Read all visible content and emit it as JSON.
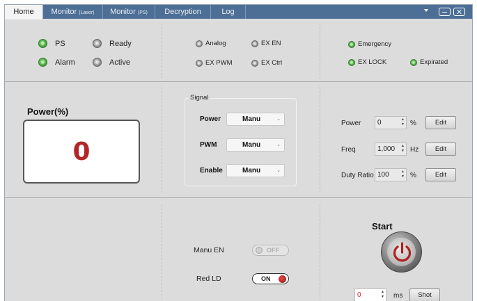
{
  "tabs": [
    {
      "label": "Home",
      "sub": ""
    },
    {
      "label": "Monitor",
      "sub": "(Laser)"
    },
    {
      "label": "Monitor",
      "sub": "(PS)"
    },
    {
      "label": "Decryption",
      "sub": ""
    },
    {
      "label": "Log",
      "sub": ""
    }
  ],
  "status": {
    "ps": {
      "label": "PS",
      "state": "green"
    },
    "ready": {
      "label": "Ready",
      "state": "gray"
    },
    "alarm": {
      "label": "Alarm",
      "state": "green"
    },
    "active": {
      "label": "Active",
      "state": "gray"
    },
    "analog": {
      "label": "Analog",
      "state": "gray"
    },
    "ex_en": {
      "label": "EX EN",
      "state": "gray"
    },
    "ex_pwm": {
      "label": "EX PWM",
      "state": "gray"
    },
    "ex_ctrl": {
      "label": "EX Ctrl",
      "state": "gray"
    },
    "emergency": {
      "label": "Emergency",
      "state": "green"
    },
    "ex_lock": {
      "label": "EX LOCK",
      "state": "green"
    },
    "expirated": {
      "label": "Expirated",
      "state": "green"
    }
  },
  "power_display": {
    "title": "Power(%)",
    "value": "0"
  },
  "signal": {
    "legend": "Signal",
    "power": {
      "label": "Power",
      "value": "Manu"
    },
    "pwm": {
      "label": "PWM",
      "value": "Manu"
    },
    "enable": {
      "label": "Enable",
      "value": "Manu"
    }
  },
  "settings": {
    "power": {
      "label": "Power",
      "value": "0",
      "unit": "%",
      "button": "Edit"
    },
    "freq": {
      "label": "Freq",
      "value": "1,000",
      "unit": "Hz",
      "button": "Edit"
    },
    "duty": {
      "label": "Duty Ratio",
      "value": "100",
      "unit": "%",
      "button": "Edit"
    }
  },
  "toggles": {
    "manu_en": {
      "label": "Manu EN",
      "state": "OFF"
    },
    "red_ld": {
      "label": "Red LD",
      "state": "ON"
    }
  },
  "start": {
    "label": "Start"
  },
  "shot": {
    "value": "0",
    "unit": "ms",
    "button": "Shot"
  },
  "colors": {
    "tabbar": "#4d6f96",
    "panel": "#dcdcdc",
    "led_green": "#4caf3f",
    "power_value": "#b32626",
    "toggle_on_knob": "#b31b1b"
  }
}
